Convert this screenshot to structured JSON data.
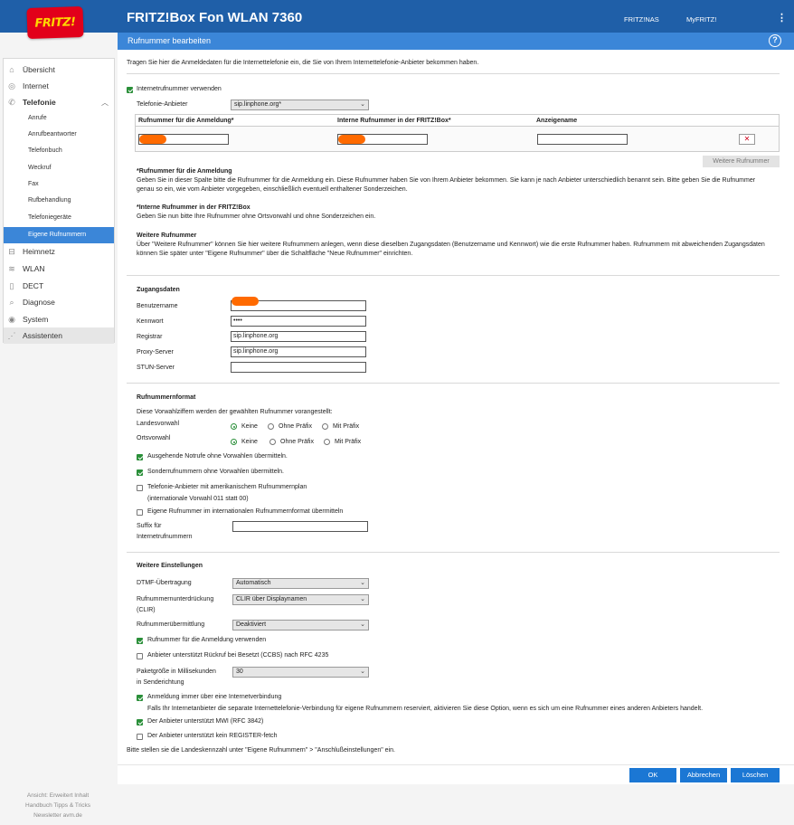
{
  "header": {
    "logo_text": "FRITZ!",
    "product": "FRITZ!Box Fon WLAN 7360",
    "link_nas": "FRITZ!NAS",
    "link_myfritz": "MyFRITZ!",
    "menu_glyph": "⋮",
    "subtitle": "Rufnummer bearbeiten",
    "help_glyph": "?"
  },
  "sidebar": {
    "items": [
      {
        "label": "Übersicht",
        "icon": "home-icon",
        "glyph": "⌂"
      },
      {
        "label": "Internet",
        "icon": "globe-icon",
        "glyph": "◎"
      },
      {
        "label": "Telefonie",
        "icon": "phone-icon",
        "glyph": "✆"
      }
    ],
    "sub_items": [
      "Anrufe",
      "Anrufbeantworter",
      "Telefonbuch",
      "Weckruf",
      "Fax",
      "Rufbehandlung",
      "Telefoniegeräte",
      "Eigene Rufnummern"
    ],
    "items2": [
      {
        "label": "Heimnetz",
        "icon": "network-icon",
        "glyph": "⊟"
      },
      {
        "label": "WLAN",
        "icon": "wifi-icon",
        "glyph": "≋"
      },
      {
        "label": "DECT",
        "icon": "dect-icon",
        "glyph": "▯"
      },
      {
        "label": "Diagnose",
        "icon": "diagnose-icon",
        "glyph": "⌕"
      },
      {
        "label": "System",
        "icon": "system-icon",
        "glyph": "◉"
      },
      {
        "label": "Assistenten",
        "icon": "wizard-icon",
        "glyph": "⋰"
      }
    ],
    "footer_line1": "Ansicht: Erweitert   Inhalt",
    "footer_line2": "Handbuch   Tipps & Tricks",
    "footer_line3": "Newsletter   avm.de",
    "accent": "#3b86d8"
  },
  "content": {
    "intro": "Tragen Sie hier die Anmeldedaten für die Internettelefonie ein, die Sie von Ihrem Internettelefonie-Anbieter bekommen haben.",
    "use_internet_number": "Internetrufnummer verwenden",
    "provider_label": "Telefonie-Anbieter",
    "provider_value": "sip.linphone.org*",
    "table": {
      "col1": "Rufnummer für die Anmeldung*",
      "col2": "Interne Rufnummer in der FRITZ!Box*",
      "col3": "Anzeigename",
      "delete_glyph": "✕"
    },
    "more_numbers_button": "Weitere Rufnummer",
    "help1_title": "*Rufnummer für die Anmeldung",
    "help1_text": "Geben Sie in dieser Spalte bitte die Rufnummer für die Anmeldung ein. Diese Rufnummer haben Sie von Ihrem Anbieter bekommen. Sie kann je nach Anbieter unterschiedlich benannt sein. Bitte geben Sie die Rufnummer genau so ein, wie vom Anbieter vorgegeben, einschließlich eventuell enthaltener Sonderzeichen.",
    "help2_title": "*Interne Rufnummer in der FRITZ!Box",
    "help2_text": "Geben Sie nun bitte Ihre Rufnummer ohne Ortsvorwahl und ohne Sonderzeichen ein.",
    "help3_title": "Weitere Rufnummer",
    "help3_text": "Über \"Weitere Rufnummer\" können Sie hier weitere Rufnummern anlegen, wenn diese dieselben Zugangsdaten (Benutzername und Kennwort) wie die erste Rufnummer haben. Rufnummern mit abweichenden Zugangsdaten können Sie später unter \"Eigene Rufnummer\" über die Schaltfläche \"Neue Rufnummer\" einrichten.",
    "access": {
      "title": "Zugangsdaten",
      "username_label": "Benutzername",
      "password_label": "Kennwort",
      "password_value": "••••",
      "registrar_label": "Registrar",
      "registrar_value": "sip.linphone.org",
      "proxy_label": "Proxy-Server",
      "proxy_value": "sip.linphone.org",
      "stun_label": "STUN-Server",
      "stun_value": ""
    },
    "format": {
      "title": "Rufnummernformat",
      "intro": "Diese Vorwahlziffern werden der gewählten Rufnummer vorangestellt:",
      "country_label": "Landesvorwahl",
      "local_label": "Ortsvorwahl",
      "opt_none": "Keine",
      "opt_no_prefix": "Ohne Präfix",
      "opt_with_prefix": "Mit Präfix",
      "emergency": "Ausgehende Notrufe ohne Vorwahlen übermitteln.",
      "special": "Sonderrufnummern ohne Vorwahlen übermitteln.",
      "american": "Telefonie-Anbieter mit amerikanischem Rufnummernplan",
      "american_note": "(internationale Vorwahl 011 statt 00)",
      "international": "Eigene Rufnummer im internationalen Rufnummernformat übermitteln",
      "suffix_label_1": "Suffix für",
      "suffix_label_2": "Internetrufnummern"
    },
    "further": {
      "title": "Weitere Einstellungen",
      "dtmf_label": "DTMF-Übertragung",
      "dtmf_value": "Automatisch",
      "clir_label_1": "Rufnummernunterdrückung",
      "clir_label_2": "(CLIR)",
      "clir_value": "CLIR über Displaynamen",
      "transmit_label": "Rufnummerübermittlung",
      "transmit_value": "Deaktiviert",
      "use_login_number": "Rufnummer für die Anmeldung verwenden",
      "ccbs": "Anbieter unterstützt Rückruf bei Besetzt (CCBS) nach RFC 4235",
      "packet_label_1": "Paketgröße in Millisekunden",
      "packet_label_2": "in Senderichtung",
      "packet_value": "30",
      "always_internet": "Anmeldung immer über eine Internetverbindung",
      "always_internet_note": "Falls Ihr Internetanbieter die separate Internettelefonie-Verbindung für eigene Rufnummern reserviert, aktivieren Sie diese Option, wenn es sich um eine Rufnummer eines anderen Anbieters handelt.",
      "mwi": "Der Anbieter unterstützt MWI (RFC 3842)",
      "register_fetch": "Der Anbieter unterstützt kein REGISTER-fetch"
    },
    "footer_note": "Bitte stellen sie die Landeskennzahl unter \"Eigene Rufnummern\" > \"Anschlußeinstellungen\" ein."
  },
  "buttons": {
    "ok": "OK",
    "cancel": "Abbrechen",
    "delete": "Löschen"
  },
  "colors": {
    "header": "#1f5fa8",
    "subbar": "#3b86d8",
    "check": "#2a8f39",
    "button": "#1b77d4",
    "redaction": "#ff6a00"
  }
}
